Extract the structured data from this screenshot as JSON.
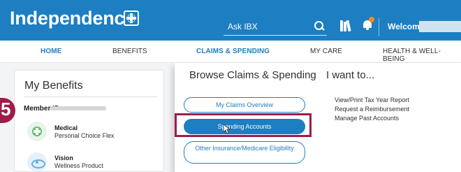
{
  "header": {
    "logo_text": "Independence",
    "search_label": "Ask IBX",
    "welcome_label": "Welcome,",
    "colors": {
      "brand_blue": "#1d7ec2",
      "notification_dot": "#f38b22"
    }
  },
  "nav": {
    "items": [
      {
        "label": "HOME",
        "active": true
      },
      {
        "label": "BENEFITS",
        "active": false
      },
      {
        "label": "CLAIMS & SPENDING",
        "active": false
      },
      {
        "label": "MY CARE",
        "active": false
      },
      {
        "label": "HEALTH & WELL-BEING",
        "active": false
      }
    ]
  },
  "benefits_card": {
    "title": "My Benefits",
    "member_label": "Member ID:",
    "items": [
      {
        "name": "Medical",
        "plan": "Personal Choice Flex",
        "icon": "medical-cross-icon"
      },
      {
        "name": "Vision",
        "plan": "Wellness Product",
        "icon": "eye-icon"
      }
    ]
  },
  "step_badge": {
    "number": "5",
    "color": "#9e1c4a"
  },
  "dropdown": {
    "browse_title": "Browse Claims & Spending",
    "browse_buttons": [
      {
        "label": "My Claims Overview"
      },
      {
        "label": "Spending Accounts",
        "selected": true
      },
      {
        "label": "Other Insurance/Medicare Eligibility"
      }
    ],
    "i_want_title": "I want to...",
    "i_want_links": [
      {
        "label": "View/Print Tax Year Report"
      },
      {
        "label": "Request a Reimbursement"
      },
      {
        "label": "Manage Past Accounts"
      }
    ]
  }
}
